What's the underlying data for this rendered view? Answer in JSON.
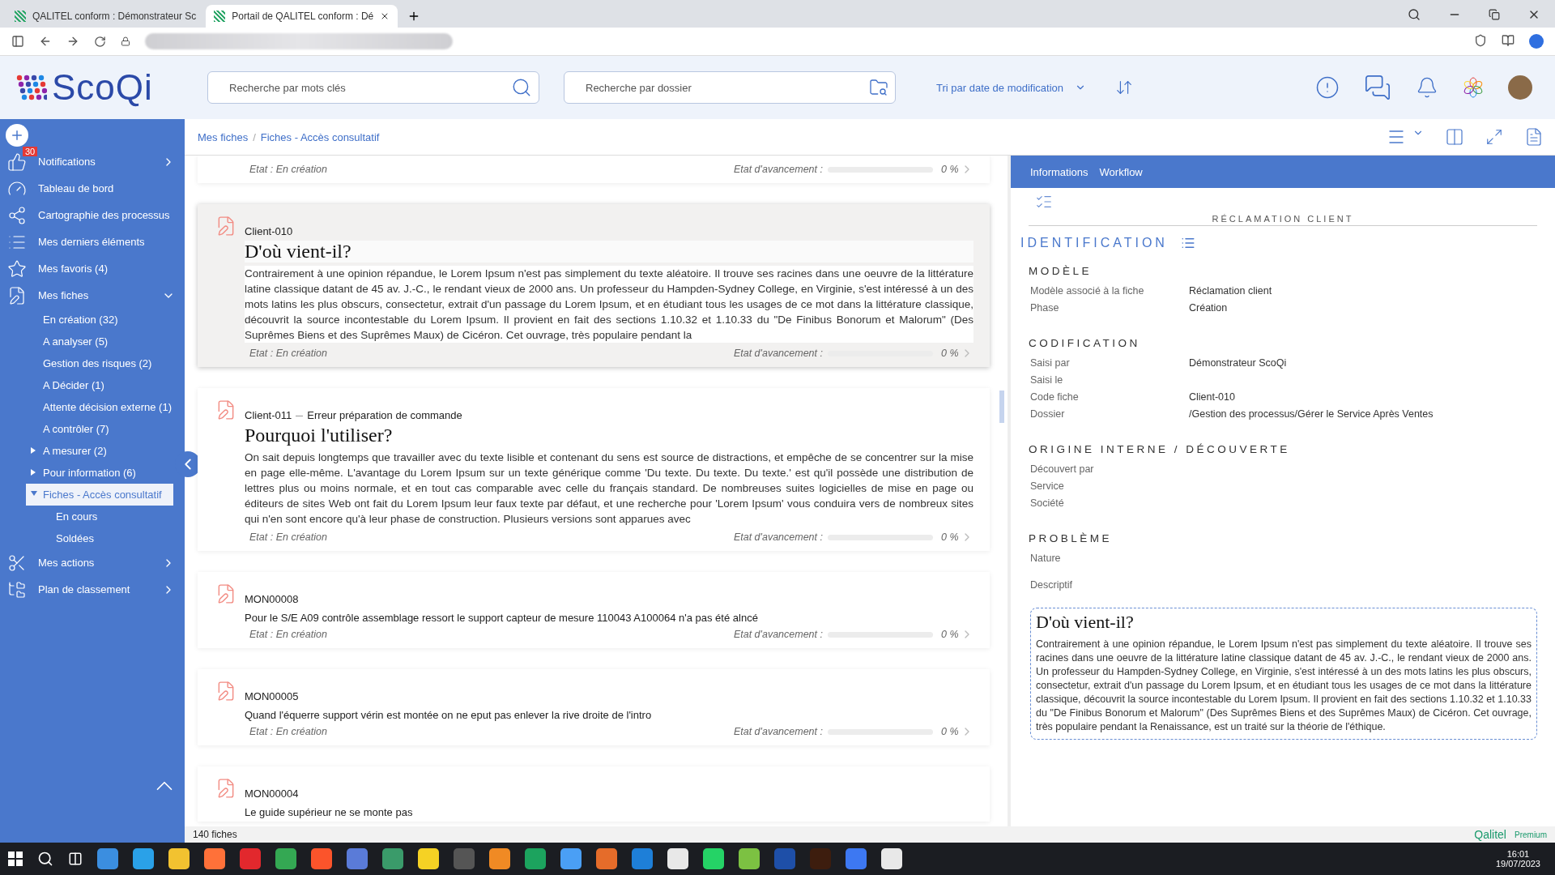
{
  "browser": {
    "tabs": [
      {
        "title": "QALITEL conform : Démonstrateur Sc",
        "selected": false
      },
      {
        "title": "Portail de QALITEL conform : Dé",
        "selected": true
      }
    ]
  },
  "header": {
    "logo": "ScoQi",
    "search_keywords": {
      "placeholder": "Recherche par mots clés"
    },
    "search_folder": {
      "placeholder": "Recherche par dossier"
    },
    "sort": "Tri par date de modification"
  },
  "sidebar": {
    "items": [
      {
        "label": "Notifications",
        "badge": "30",
        "expanded": false
      },
      {
        "label": "Tableau de bord"
      },
      {
        "label": "Cartographie des processus"
      },
      {
        "label": "Mes derniers éléments"
      },
      {
        "label": "Mes favoris (4)"
      },
      {
        "label": "Mes fiches",
        "expanded": true,
        "children": [
          {
            "label": "En création (32)",
            "selected": false
          },
          {
            "label": "A analyser (5)",
            "selected": false
          },
          {
            "label": "Gestion des risques (2)",
            "selected": false
          },
          {
            "label": "A Décider (1)",
            "selected": false
          },
          {
            "label": "Attente décision externe (1)",
            "selected": false
          },
          {
            "label": "A contrôler (7)",
            "selected": false
          },
          {
            "label": "A mesurer (2)",
            "selected": false,
            "expanded": false
          },
          {
            "label": "Pour information (6)",
            "selected": false,
            "expanded": false
          },
          {
            "label": "Fiches - Accès consultatif",
            "selected": true,
            "expanded": true,
            "children": [
              {
                "label": "En cours",
                "selected": false
              },
              {
                "label": "Soldées",
                "selected": false
              }
            ]
          }
        ]
      },
      {
        "label": "Mes actions",
        "expanded": false
      },
      {
        "label": "Plan de classement",
        "expanded": false
      }
    ]
  },
  "breadcrumb": {
    "items": [
      "Mes fiches",
      "Fiches - Accès consultatif"
    ],
    "separator": "/"
  },
  "cards": [
    {
      "selected": false,
      "status": "Etat : En création",
      "progress_label": "Etat d'avancement :",
      "level": 0,
      "percent": "0 %"
    },
    {
      "selected": true,
      "code": "Client-010",
      "title": "D'où vient-il?",
      "body": "Contrairement à une opinion répandue, le Lorem Ipsum n'est pas simplement du texte aléatoire. Il trouve ses racines dans une oeuvre de la littérature latine classique datant de 45 av. J.-C., le rendant vieux de 2000 ans. Un professeur du Hampden-Sydney College, en Virginie, s'est intéressé à un des mots latins les plus obscurs, consectetur, extrait d'un passage du Lorem Ipsum, et en étudiant tous les usages de ce mot dans la littérature classique, découvrit la source incontestable du Lorem Ipsum. Il provient en fait des sections 1.10.32 et 1.10.33 du \"De Finibus Bonorum et Malorum\" (Des Suprêmes Biens et des Suprêmes Maux) de Cicéron. Cet ouvrage, très populaire pendant la",
      "status": "Etat : En création",
      "progress_label": "Etat d'avancement :",
      "level": 0,
      "percent": "0 %"
    },
    {
      "selected": false,
      "code": "Client-011",
      "subtitle": "Erreur préparation de commande",
      "title": "Pourquoi l'utiliser?",
      "body": "On sait depuis longtemps que travailler avec du texte lisible et contenant du sens est source de distractions, et empêche de se concentrer sur la mise en page elle-même. L'avantage du Lorem Ipsum sur un texte générique comme 'Du texte. Du texte. Du texte.' est qu'il possède une distribution de lettres plus ou moins normale, et en tout cas comparable avec celle du français standard. De nombreuses suites logicielles de mise en page ou éditeurs de sites Web ont fait du Lorem Ipsum leur faux texte par défaut, et une recherche pour 'Lorem Ipsum' vous conduira vers de nombreux sites qui n'en sont encore qu'à leur phase de construction. Plusieurs versions sont apparues avec",
      "status": "Etat : En création",
      "progress_label": "Etat d'avancement :",
      "level": 0,
      "percent": "0 %"
    },
    {
      "selected": false,
      "code": "MON00008",
      "text": "Pour le S/E A09 contrôle assemblage ressort le support capteur de mesure 110043 A100064 n'a pas été alncé",
      "status": "Etat : En création",
      "progress_label": "Etat d'avancement :",
      "level": 0,
      "percent": "0 %"
    },
    {
      "selected": false,
      "code": "MON00005",
      "text": "Quand l'équerre support vérin est montée on ne eput pas enlever la rive droite de l'intro",
      "status": "Etat : En création",
      "progress_label": "Etat d'avancement :",
      "level": 0,
      "percent": "0 %"
    },
    {
      "selected": false,
      "code": "MON00004",
      "text": "Le guide supérieur ne se monte pas"
    }
  ],
  "status_bar": {
    "count": "140 fiches",
    "brand": "Qalitel",
    "edition": "Premium"
  },
  "detail": {
    "tabs": [
      "Informations",
      "Workflow"
    ],
    "title": "RÉCLAMATION CLIENT",
    "section": "IDENTIFICATION",
    "groups": [
      {
        "heading": "MODÈLE",
        "fields": [
          {
            "label": "Modèle associé à la fiche",
            "value": "Réclamation client"
          },
          {
            "label": "Phase",
            "value": "Création"
          }
        ]
      },
      {
        "heading": "CODIFICATION",
        "fields": [
          {
            "label": "Saisi par",
            "value": "Démonstrateur ScoQi"
          },
          {
            "label": "Saisi le"
          },
          {
            "label": "Code fiche",
            "value": "Client-010"
          },
          {
            "label": "Dossier",
            "value": "/Gestion des processus/Gérer le Service Après Ventes"
          }
        ]
      },
      {
        "heading": "ORIGINE INTERNE / DÉCOUVERTE",
        "fields": [
          {
            "label": "Découvert par"
          },
          {
            "label": "Service"
          },
          {
            "label": "Société"
          }
        ]
      },
      {
        "heading": "PROBLÈME",
        "fields": [
          {
            "label": "Nature"
          }
        ]
      }
    ],
    "description_label": "Descriptif",
    "description": {
      "title": "D'où vient-il?",
      "body": "Contrairement à une opinion répandue, le Lorem Ipsum n'est pas simplement du texte aléatoire. Il trouve ses racines dans une oeuvre de la littérature latine classique datant de 45 av. J.-C., le rendant vieux de 2000 ans. Un professeur du Hampden-Sydney College, en Virginie, s'est intéressé à un des mots latins les plus obscurs, consectetur, extrait d'un passage du Lorem Ipsum, et en étudiant tous les usages de ce mot dans la littérature classique, découvrit la source incontestable du Lorem Ipsum. Il provient en fait des sections 1.10.32 et 1.10.33 du \"De Finibus Bonorum et Malorum\" (Des Suprêmes Biens et des Suprêmes Maux) de Cicéron. Cet ouvrage, très populaire pendant la Renaissance, est un traité sur la théorie de l'éthique."
    }
  },
  "taskbar": {
    "time": "16:01",
    "date": "19/07/2023"
  }
}
